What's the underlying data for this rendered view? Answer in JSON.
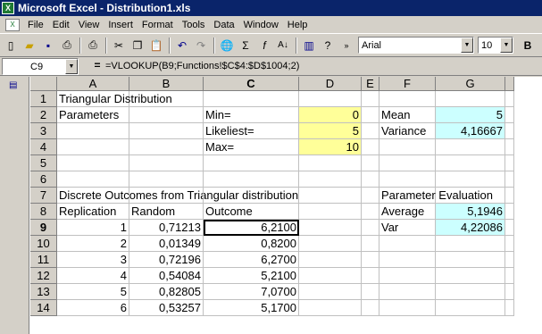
{
  "window": {
    "title": "Microsoft Excel - Distribution1.xls",
    "app_icon": "X"
  },
  "menu": [
    "File",
    "Edit",
    "View",
    "Insert",
    "Format",
    "Tools",
    "Data",
    "Window",
    "Help"
  ],
  "toolbar": {
    "font_name": "Arial",
    "font_size": "10",
    "bold": "B"
  },
  "formula_bar": {
    "name_box": "C9",
    "equals": "=",
    "formula": "=VLOOKUP(B9;Functions!$C$4:$D$1004;2)"
  },
  "columns": [
    "A",
    "B",
    "C",
    "D",
    "E",
    "F",
    "G"
  ],
  "rows": [
    "1",
    "2",
    "3",
    "4",
    "5",
    "6",
    "7",
    "8",
    "9",
    "10",
    "11",
    "12",
    "13",
    "14"
  ],
  "cells": {
    "A1": "Triangular Distribution",
    "A2": "Parameters",
    "C2": "Min=",
    "D2": "0",
    "F2": "Mean",
    "G2": "5",
    "C3": "Likeliest=",
    "D3": "5",
    "F3": "Variance",
    "G3": "4,16667",
    "C4": "Max=",
    "D4": "10",
    "A7": "Discrete Outcomes from Triangular distribution",
    "F7": "Parameter Evaluation",
    "A8": "Replication",
    "B8": "Random",
    "C8": "Outcome",
    "F8": "Average",
    "G8": "5,1946",
    "F9": "Var",
    "G9": "4,22086",
    "A9": "1",
    "B9": "0,71213",
    "C9": "6,2100",
    "A10": "2",
    "B10": "0,01349",
    "C10": "0,8200",
    "A11": "3",
    "B11": "0,72196",
    "C11": "6,2700",
    "A12": "4",
    "B12": "0,54084",
    "C12": "5,2100",
    "A13": "5",
    "B13": "0,82805",
    "C13": "7,0700",
    "A14": "6",
    "B14": "0,53257",
    "C14": "5,1700"
  },
  "colors": {
    "yellow_fill": "#ffff99",
    "cyan_fill": "#ccffff",
    "title_bar": "#0a246a"
  }
}
